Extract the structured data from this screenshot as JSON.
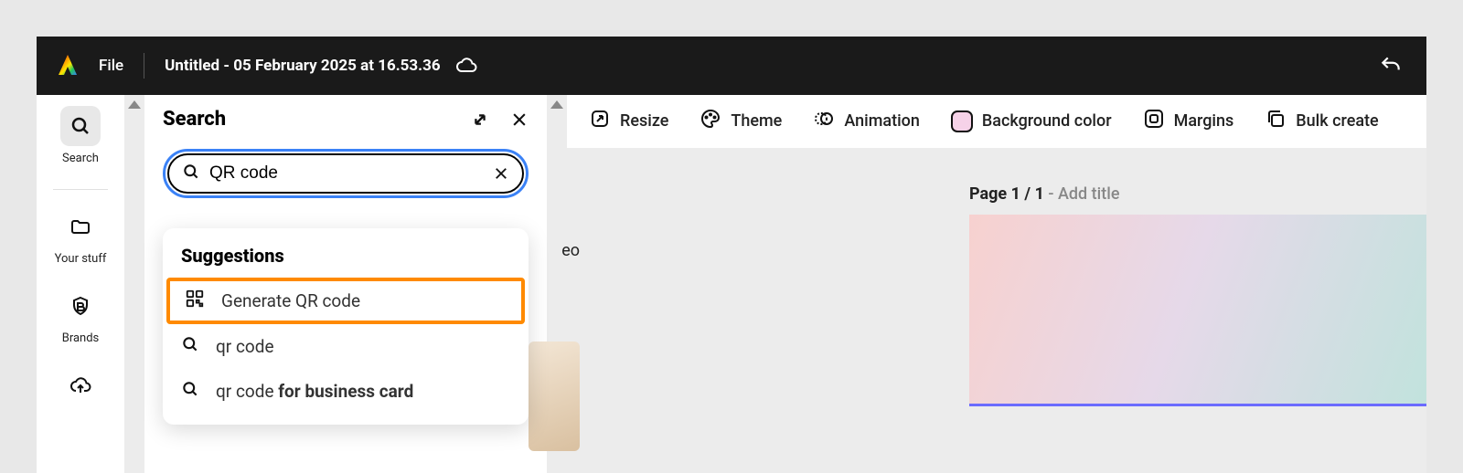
{
  "topbar": {
    "file_label": "File",
    "doc_title": "Untitled - 05 February 2025 at 16.53.36"
  },
  "left_rail": {
    "items": [
      {
        "label": "Search"
      },
      {
        "label": "Your stuff"
      },
      {
        "label": "Brands"
      }
    ]
  },
  "search_panel": {
    "title": "Search",
    "input_value": "QR code",
    "suggestions_title": "Suggestions",
    "suggestions": [
      {
        "label": "Generate QR code",
        "highlighted": true,
        "bold_part": ""
      },
      {
        "label": "qr code",
        "highlighted": false,
        "bold_part": ""
      },
      {
        "label_prefix": "qr code ",
        "bold_part": "for business card",
        "highlighted": false
      }
    ],
    "behind_tab_fragment": "eo"
  },
  "context_toolbar": {
    "items": [
      {
        "label": "Resize"
      },
      {
        "label": "Theme"
      },
      {
        "label": "Animation"
      },
      {
        "label": "Background color"
      },
      {
        "label": "Margins"
      },
      {
        "label": "Bulk create"
      }
    ]
  },
  "canvas": {
    "page_label_main": "Page 1 / 1",
    "page_label_hint": " - Add title"
  }
}
